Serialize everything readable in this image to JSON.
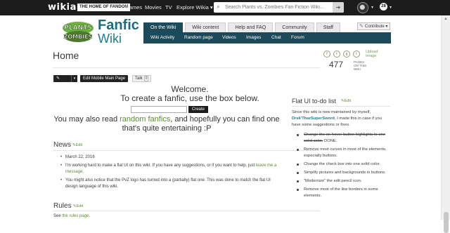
{
  "global_nav": {
    "logo": "wikia",
    "tagline": "THE HOME OF FANDOM",
    "links": [
      "Games",
      "Movies",
      "TV",
      "Explore Wikia ▾"
    ],
    "search_placeholder": "Search Plants vs. Zombies Fan Fiction Wiki...",
    "notif_count": "28",
    "caret": "▾"
  },
  "wiki": {
    "logo_alt": "PLANTS vs ZOMBIES",
    "title_line1": "Fanfic",
    "title_line2": "Wiki",
    "tabs": [
      "On the Wiki",
      "Wiki content",
      "Help and FAQ",
      "Community",
      "Staff"
    ],
    "subnav": [
      "Wiki Activity",
      "Random page",
      "Videos",
      "Images",
      "Chat",
      "Forum"
    ],
    "contribute": "Contribute ▾"
  },
  "page": {
    "title": "Home",
    "page_count": "477",
    "page_count_label": "PAGES ON THIS WIKI",
    "upload_label": "Upload Image",
    "social_icons": [
      "f",
      "t",
      "g",
      "t"
    ],
    "edit_label": "Edit",
    "edit_mobile_label": "Edit Mobile Main Page",
    "talk_label": "Talk",
    "talk_count": "0"
  },
  "main": {
    "welcome_line1": "Welcome.",
    "welcome_line2": "To create a fanfic, use the box below.",
    "create_button": "Create",
    "also_read_prefix": "You may also read ",
    "also_read_link": "random fanfics",
    "also_read_suffix": ", and hopefully you can find one that's quite entertaining :P",
    "news_heading": "News",
    "edit_link": "Edit",
    "news_items": [
      {
        "text": "March 22, 2016"
      },
      {
        "text": "I'm working hard to make a flat UI on this wiki. If you have any suggestions, or if you want to help, just ",
        "link": "leave me a message",
        "suffix": "."
      },
      {
        "text": "You might also notice that the PvZ logo has turned into a (partially) flat one. This was done to match the flat UI design language of this wiki."
      }
    ],
    "rules_heading": "Rules",
    "rules_prefix": "See ",
    "rules_link": "the rules page",
    "rules_suffix": "."
  },
  "rail": {
    "title": "Flat UI to-do list",
    "edit_link": "Edit",
    "intro_prefix": "Since this wiki is now maintained by myself, ",
    "intro_link": "Drek'TharSuperSword",
    "intro_suffix": ", I made this in case if you have some suggestions or fixes.",
    "items": [
      {
        "struck": "Change the on-hover button highlights to one solid color.",
        "text": " DONE."
      },
      {
        "text": "Remove most curves in most of the elements, especially buttons."
      },
      {
        "text": "Change the check box into one solid color."
      },
      {
        "text": "Simplify pictures and backgrounds in buttons."
      },
      {
        "text": "\"Modernize\" the edit pencil icon."
      },
      {
        "text": "Remove most of the line borders in some elements."
      }
    ]
  },
  "colors": {
    "nav_dark": "#1c1c1c",
    "tab_active": "#1c4a5a",
    "link_green": "#5d8a2f",
    "title_teal": "#1f6b7a"
  }
}
